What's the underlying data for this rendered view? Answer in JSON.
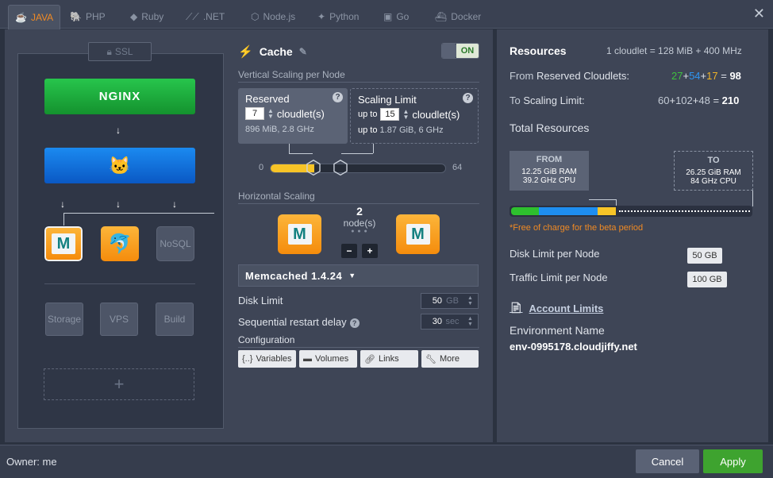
{
  "tabs": [
    {
      "label": "JAVA",
      "icon": "java-icon"
    },
    {
      "label": "PHP",
      "icon": "php-icon"
    },
    {
      "label": "Ruby",
      "icon": "ruby-icon"
    },
    {
      "label": ".NET",
      "icon": "dotnet-icon"
    },
    {
      "label": "Node.js",
      "icon": "nodejs-icon"
    },
    {
      "label": "Python",
      "icon": "python-icon"
    },
    {
      "label": "Go",
      "icon": "go-icon"
    },
    {
      "label": "Docker",
      "icon": "docker-icon"
    }
  ],
  "topology": {
    "ssl_label": "SSL",
    "balancer_label": "NGINX",
    "nosql_label": "NoSQL",
    "storage_label": "Storage",
    "vps_label": "VPS",
    "build_label": "Build",
    "add_symbol": "+"
  },
  "cache": {
    "title": "Cache",
    "toggle_label": "ON",
    "vertical_scaling_label": "Vertical Scaling per Node",
    "reserved": {
      "title": "Reserved",
      "value": "7",
      "unit": "cloudlet(s)",
      "info": "896 MiB, 2.8 GHz"
    },
    "scaling_limit": {
      "title": "Scaling Limit",
      "prefix": "up to",
      "value": "15",
      "unit": "cloudlet(s)",
      "info_prefix": "up to",
      "info": "1.87 GiB, 6 GHz"
    },
    "slider": {
      "min": "0",
      "max": "64",
      "reserved": 7,
      "limit": 15
    },
    "horizontal_scaling_label": "Horizontal Scaling",
    "node_count": "2",
    "node_count_label": "node(s)",
    "minus": "−",
    "plus": "+",
    "version": "Memcached 1.4.24",
    "disk_limit_label": "Disk Limit",
    "disk_limit_value": "50",
    "disk_limit_unit": "GB",
    "restart_delay_label": "Sequential restart delay",
    "restart_delay_value": "30",
    "restart_delay_unit": "sec",
    "configuration_label": "Configuration",
    "config_buttons": [
      "Variables",
      "Volumes",
      "Links",
      "More"
    ]
  },
  "resources": {
    "title": "Resources",
    "cloudlet_note": "1 cloudlet = 128 MiB + 400 MHz",
    "reserved_prefix": "From",
    "reserved_label": "Reserved Cloudlets:",
    "reserved_parts": [
      "27",
      "+",
      "54",
      "+",
      "17",
      "="
    ],
    "reserved_total": "98",
    "limit_prefix": "To",
    "limit_label": "Scaling Limit:",
    "limit_parts": [
      "60",
      "+",
      "102",
      "+",
      "48",
      "="
    ],
    "limit_total": "210",
    "total_label": "Total Resources",
    "from": {
      "label": "FROM",
      "ram": "12.25 GiB RAM",
      "cpu": "39.2 GHz CPU"
    },
    "to": {
      "label": "TO",
      "ram": "26.25 GiB RAM",
      "cpu": "84 GHz CPU"
    },
    "beta_note": "*Free of charge for the beta period",
    "disk_limit_label": "Disk Limit per Node",
    "disk_limit_value": "50 GB",
    "traffic_limit_label": "Traffic Limit per Node",
    "traffic_limit_value": "100 GB",
    "account_limits": "Account Limits",
    "env_name_label": "Environment Name",
    "env_name": "env-0995178.cloudjiffy.net"
  },
  "footer": {
    "owner": "Owner: me",
    "cancel": "Cancel",
    "apply": "Apply"
  },
  "colors": {
    "accent": "#f08a24",
    "green": "#3ea32f",
    "blue": "#1b8af0",
    "yellow": "#f7c427"
  }
}
